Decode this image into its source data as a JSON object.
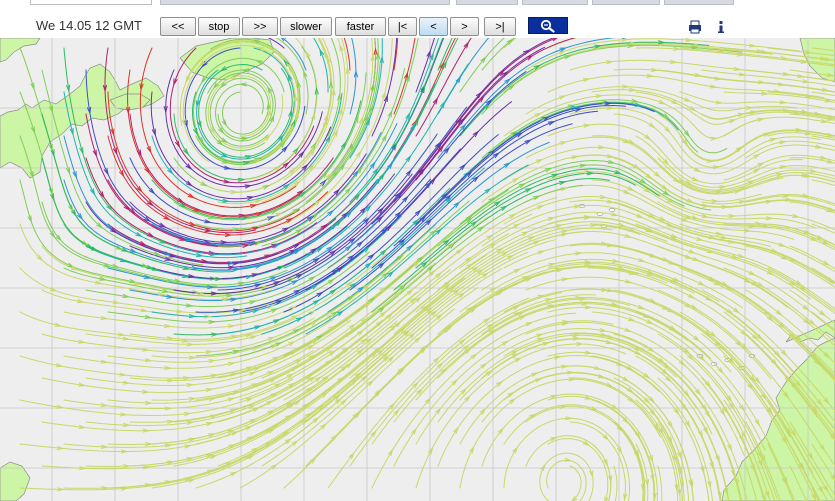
{
  "header": {
    "timestamp": "We 14.05 12 GMT"
  },
  "controls": {
    "rewind": "<<",
    "stop": "stop",
    "forward": ">>",
    "slower": "slower",
    "faster": "faster",
    "first": "|<",
    "prev": "<",
    "next": ">",
    "last": ">|"
  },
  "icons": {
    "zoom": "zoom-in-magnifier-icon",
    "print": "print-icon",
    "info": "info-icon"
  },
  "map": {
    "type": "surface-wind-streamlines",
    "grid": true,
    "colors": {
      "sea": "#eeeeee",
      "land": "#cdf5a6",
      "coast": "#8d8d8d",
      "grid": "#c8c8c8",
      "wind_scale": [
        "#c8d86a",
        "#7fcf55",
        "#2fbb63",
        "#1fb4b0",
        "#2a95d4",
        "#3b4fc4",
        "#6a2ea8",
        "#b2206e",
        "#d7352c"
      ]
    }
  }
}
